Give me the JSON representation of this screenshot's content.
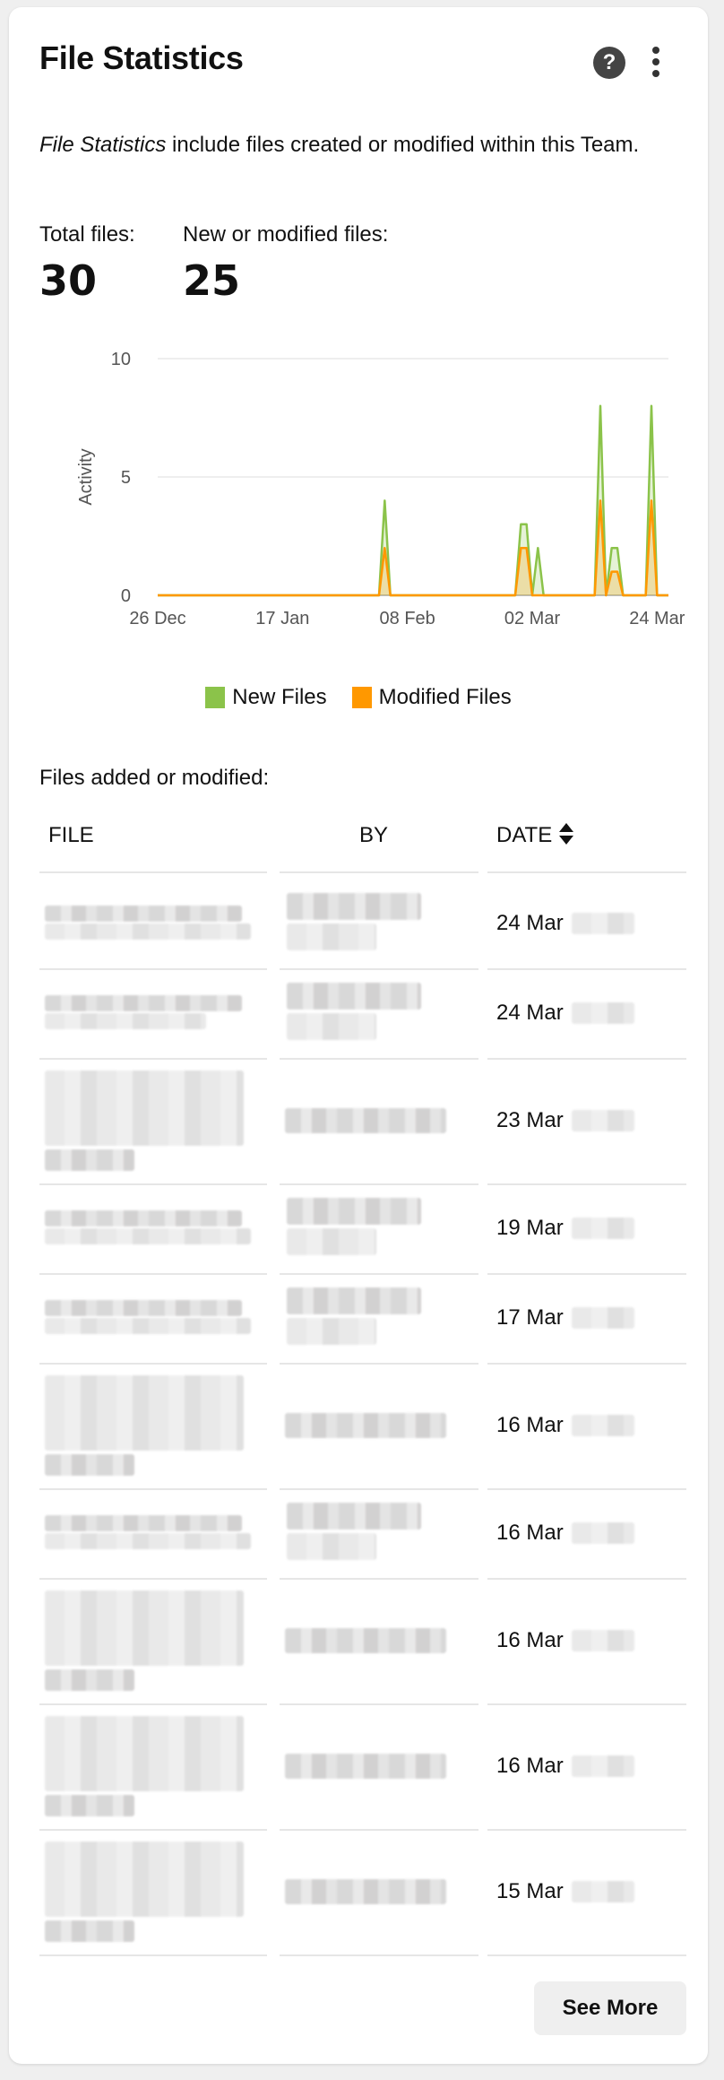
{
  "header": {
    "title": "File Statistics"
  },
  "description": {
    "emphasis": "File Statistics",
    "rest": " include files created or modified within this Team."
  },
  "stats": {
    "total_label": "Total files:",
    "total_value": "30",
    "new_label": "New or modified files:",
    "new_value": "25"
  },
  "chart_data": {
    "type": "area",
    "title": "",
    "xlabel": "",
    "ylabel": "Activity",
    "ylim": [
      0,
      10
    ],
    "yticks": [
      "0",
      "5",
      "10"
    ],
    "xticks": [
      "26 Dec",
      "17 Jan",
      "08 Feb",
      "02 Mar",
      "24 Mar"
    ],
    "x": [
      "26 Dec",
      "27 Dec",
      "28 Dec",
      "29 Dec",
      "30 Dec",
      "31 Dec",
      "01 Jan",
      "02 Jan",
      "03 Jan",
      "04 Jan",
      "05 Jan",
      "06 Jan",
      "07 Jan",
      "08 Jan",
      "09 Jan",
      "10 Jan",
      "11 Jan",
      "12 Jan",
      "13 Jan",
      "14 Jan",
      "15 Jan",
      "16 Jan",
      "17 Jan",
      "18 Jan",
      "19 Jan",
      "20 Jan",
      "21 Jan",
      "22 Jan",
      "23 Jan",
      "24 Jan",
      "25 Jan",
      "26 Jan",
      "27 Jan",
      "28 Jan",
      "29 Jan",
      "30 Jan",
      "31 Jan",
      "01 Feb",
      "02 Feb",
      "03 Feb",
      "04 Feb",
      "05 Feb",
      "06 Feb",
      "07 Feb",
      "08 Feb",
      "09 Feb",
      "10 Feb",
      "11 Feb",
      "12 Feb",
      "13 Feb",
      "14 Feb",
      "15 Feb",
      "16 Feb",
      "17 Feb",
      "18 Feb",
      "19 Feb",
      "20 Feb",
      "21 Feb",
      "22 Feb",
      "23 Feb",
      "24 Feb",
      "25 Feb",
      "26 Feb",
      "27 Feb",
      "28 Feb",
      "01 Mar",
      "02 Mar",
      "03 Mar",
      "04 Mar",
      "05 Mar",
      "06 Mar",
      "07 Mar",
      "08 Mar",
      "09 Mar",
      "10 Mar",
      "11 Mar",
      "12 Mar",
      "13 Mar",
      "14 Mar",
      "15 Mar",
      "16 Mar",
      "17 Mar",
      "18 Mar",
      "19 Mar",
      "20 Mar",
      "21 Mar",
      "22 Mar",
      "23 Mar",
      "24 Mar",
      "25 Mar",
      "26 Mar"
    ],
    "series": [
      {
        "name": "New Files",
        "color": "#8bc34a",
        "values": [
          0,
          0,
          0,
          0,
          0,
          0,
          0,
          0,
          0,
          0,
          0,
          0,
          0,
          0,
          0,
          0,
          0,
          0,
          0,
          0,
          0,
          0,
          0,
          0,
          0,
          0,
          0,
          0,
          0,
          0,
          0,
          0,
          0,
          0,
          0,
          0,
          0,
          0,
          0,
          0,
          4,
          0,
          0,
          0,
          0,
          0,
          0,
          0,
          0,
          0,
          0,
          0,
          0,
          0,
          0,
          0,
          0,
          0,
          0,
          0,
          0,
          0,
          0,
          0,
          3,
          3,
          0,
          2,
          0,
          0,
          0,
          0,
          0,
          0,
          0,
          0,
          0,
          0,
          8,
          0,
          2,
          2,
          0,
          0,
          0,
          0,
          0,
          8,
          0,
          0,
          0
        ]
      },
      {
        "name": "Modified Files",
        "color": "#ff9800",
        "values": [
          0,
          0,
          0,
          0,
          0,
          0,
          0,
          0,
          0,
          0,
          0,
          0,
          0,
          0,
          0,
          0,
          0,
          0,
          0,
          0,
          0,
          0,
          0,
          0,
          0,
          0,
          0,
          0,
          0,
          0,
          0,
          0,
          0,
          0,
          0,
          0,
          0,
          0,
          0,
          0,
          2,
          0,
          0,
          0,
          0,
          0,
          0,
          0,
          0,
          0,
          0,
          0,
          0,
          0,
          0,
          0,
          0,
          0,
          0,
          0,
          0,
          0,
          0,
          0,
          2,
          2,
          0,
          0,
          0,
          0,
          0,
          0,
          0,
          0,
          0,
          0,
          0,
          0,
          4,
          0,
          1,
          1,
          0,
          0,
          0,
          0,
          0,
          4,
          0,
          0,
          0
        ]
      }
    ],
    "legend_position": "bottom-center",
    "grid": true
  },
  "files_section": {
    "heading": "Files added or modified:"
  },
  "table": {
    "columns": {
      "file": "FILE",
      "by": "BY",
      "date": "DATE"
    },
    "rows": [
      {
        "date": "24 Mar"
      },
      {
        "date": "24 Mar"
      },
      {
        "date": "23 Mar"
      },
      {
        "date": "19 Mar"
      },
      {
        "date": "17 Mar"
      },
      {
        "date": "16 Mar"
      },
      {
        "date": "16 Mar"
      },
      {
        "date": "16 Mar"
      },
      {
        "date": "16 Mar"
      },
      {
        "date": "15 Mar"
      }
    ]
  },
  "actions": {
    "see_more": "See More"
  },
  "colors": {
    "new_files": "#8bc34a",
    "modified_files": "#ff9800"
  }
}
